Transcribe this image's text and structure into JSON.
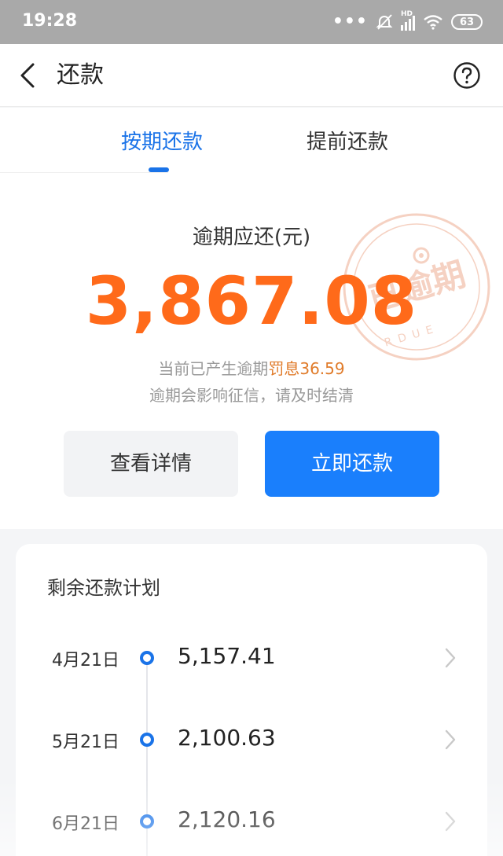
{
  "status_bar": {
    "time": "19:28",
    "signal_label": "HD",
    "battery": "63"
  },
  "header": {
    "title": "还款"
  },
  "tabs": [
    {
      "label": "按期还款",
      "active": true
    },
    {
      "label": "提前还款",
      "active": false
    }
  ],
  "summary": {
    "label": "逾期应还(元)",
    "amount": "3,867.08",
    "penalty_prefix": "当前已产生逾期",
    "penalty_label": "罚息",
    "penalty_value": "36.59",
    "warning": "逾期会影响征信，请及时结清",
    "stamp_text": "已逾期",
    "stamp_subtext": "RDUE"
  },
  "buttons": {
    "details_label": "查看详情",
    "repay_label": "立即还款"
  },
  "plan": {
    "title": "剩余还款计划",
    "rows": [
      {
        "date": "4月21日",
        "amount": "5,157.41"
      },
      {
        "date": "5月21日",
        "amount": "2,100.63"
      },
      {
        "date": "6月21日",
        "amount": "2,120.16"
      }
    ]
  },
  "colors": {
    "accent": "#1a73e8",
    "primary_button": "#1a7ffc",
    "amount": "#ff6a1a",
    "stamp": "#e88f68"
  }
}
